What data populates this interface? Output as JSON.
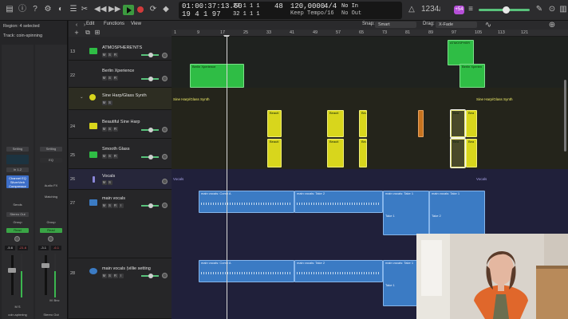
{
  "inspector": {
    "region_label": "Region: 4 selected",
    "track_label": "Track: coin-spinning",
    "strip_left": {
      "setting": "Setting",
      "input": "In 1-2",
      "plugin": "Channel EQ SilverVerb Compressor",
      "sends": "Sends",
      "output": "Stereo Out",
      "group": "Group",
      "automation": "Read",
      "vol_a": "-5.6",
      "vol_b": "-21.6",
      "ms": "M  S",
      "name": "coin-spinning"
    },
    "strip_right": {
      "setting": "Setting",
      "eq": "EQ",
      "plugin": "Audio FX",
      "sends": "Matching",
      "group": "Group",
      "automation": "Read",
      "vol_a": "-3.1",
      "vol_b": "-6.1",
      "ms": "M",
      "bnc": "Bnc",
      "name": "Stereo Out"
    }
  },
  "transport": {
    "smpte": "01:00:37:13.60",
    "bars": "19  4  1   97",
    "pos_top": "27  1  1     1",
    "pos_bot": "32  1  1     1",
    "tempo_bars": "48",
    "tempo": "120,0000",
    "tempo_label": "Keep Tempo",
    "signature": "4/4",
    "division": "/16",
    "in_label": "No In",
    "out_label": "No Out",
    "badge": "+54"
  },
  "menubar": {
    "edit": "Edit",
    "functions": "Functions",
    "view": "View",
    "snap_label": "Snap:",
    "snap_value": "Smart",
    "drag_label": "Drag:",
    "drag_value": "X-Fade"
  },
  "ruler": {
    "ticks": [
      "1",
      "9",
      "17",
      "25",
      "33",
      "41",
      "49",
      "57",
      "65",
      "73",
      "81",
      "89",
      "97",
      "105",
      "113",
      "121"
    ]
  },
  "tracks": [
    {
      "num": "13",
      "name": "ATMOSPHERE'NTS",
      "color": "#2fbd45"
    },
    {
      "num": "22",
      "name": "Berlin Xperience",
      "color": "#2fbd45"
    },
    {
      "num": "",
      "name": "Sine Harp/Glass Synth",
      "color": "#d8d61c"
    },
    {
      "num": "24",
      "name": "Beautiful Sine Harp",
      "color": "#d8d61c"
    },
    {
      "num": "25",
      "name": "Smooth Glass",
      "color": "#d8d61c"
    },
    {
      "num": "26",
      "name": "Vocals",
      "color": "#8a86d8"
    },
    {
      "num": "27",
      "name": "main vocals",
      "color": "#3b7bc4"
    },
    {
      "num": "28",
      "name": "main vocals (villie setting",
      "color": "#3b7bc4"
    }
  ],
  "msr_text": {
    "m": "M",
    "s": "S",
    "r": "R",
    "i": "I"
  },
  "regions": {
    "atmos": "ATMOSPHER",
    "berlin_a": "Berlin Xperience",
    "berlin_b": "Berlin Xperien",
    "folder_a": "Sine Harp/Glass Synth",
    "folder_b": "Sine Harp/Glass Synth",
    "harp": "Beauti",
    "harp_short": "Bea",
    "vocals_a": "Vocals",
    "vocals_b": "Vocals",
    "comp_a": "main vocals: Comp A",
    "take_2": "main vocals: Take 2",
    "take_1": "main vocals: Take 1",
    "take_1_short": "Take 1",
    "take_2_short": "Take 2"
  },
  "colors": {
    "green_region": "#2fbd45",
    "yellow_region": "#d8d61c",
    "blue_region": "#3b7bc4",
    "orange_region": "#c7731f",
    "play_button": "#3c9a3f"
  }
}
